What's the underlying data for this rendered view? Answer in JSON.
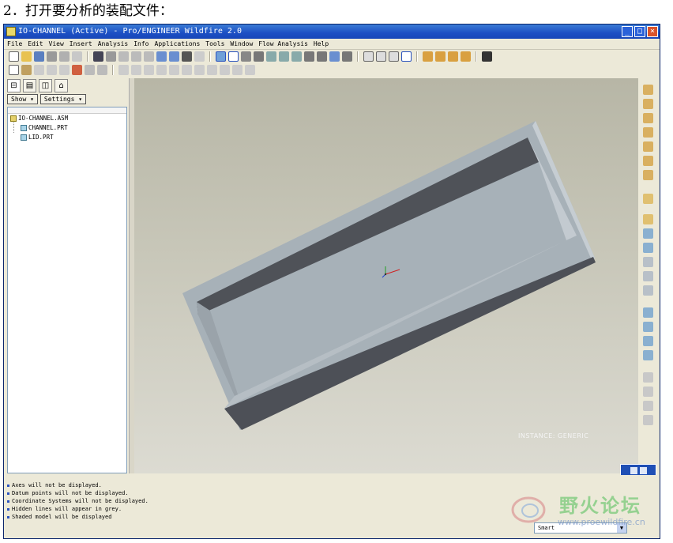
{
  "document": {
    "heading": "2．打开要分析的装配文件："
  },
  "window": {
    "title": "IO-CHANNEL (Active) - Pro/ENGINEER Wildfire 2.0",
    "controls": [
      "_",
      "□",
      "×"
    ]
  },
  "menu": {
    "items": [
      "File",
      "Edit",
      "View",
      "Insert",
      "Analysis",
      "Info",
      "Applications",
      "Tools",
      "Window",
      "Flow Analysis",
      "Help"
    ]
  },
  "left_panel": {
    "show_label": "Show",
    "settings_label": "Settings",
    "tree": {
      "root": "IO-CHANNEL.ASM",
      "children": [
        "CHANNEL.PRT",
        "LID.PRT"
      ]
    }
  },
  "viewport": {
    "instance_label": "INSTANCE: GENERIC"
  },
  "messages": [
    "Axes will not be displayed.",
    "Datum points will not be displayed.",
    "Coordinate Systems will not be displayed.",
    "Hidden lines will appear in grey.",
    "Shaded model will be displayed"
  ],
  "status": {
    "smart_filter": "Smart"
  },
  "watermark": {
    "text": "野火论坛",
    "url": "www.proewildfire.cn"
  },
  "colors": {
    "titlebar": "#1c4fc4",
    "frame_top": "#a7b1b8",
    "frame_inner": "#4d5057",
    "viewport_bg": "#c8c7b9"
  }
}
